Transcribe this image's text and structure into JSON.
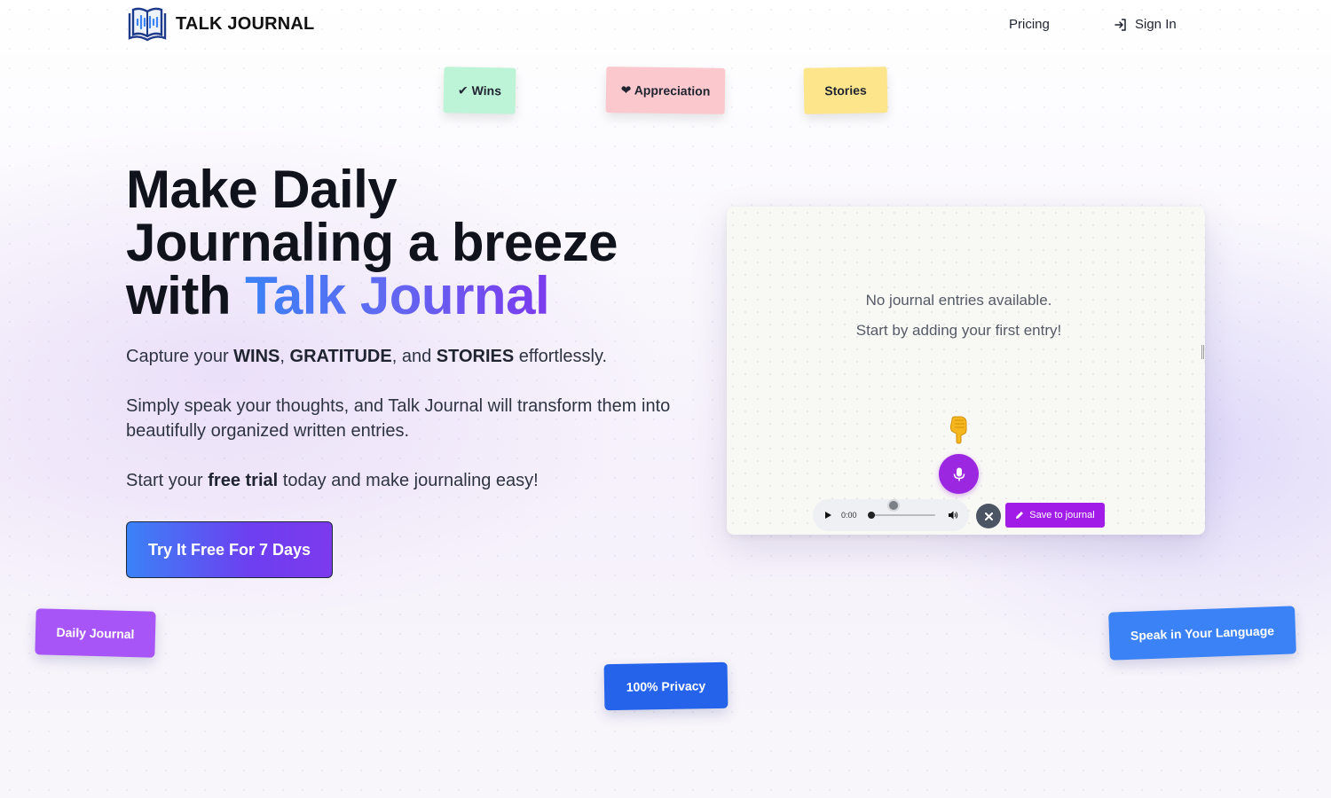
{
  "header": {
    "brand": "TALK JOURNAL",
    "nav": {
      "pricing": "Pricing",
      "sign_in": "Sign In"
    }
  },
  "tags": {
    "wins": "✔ Wins",
    "appreciation": "❤ Appreciation",
    "stories": "Stories"
  },
  "hero": {
    "title_lines": [
      "Make Daily",
      "Journaling a breeze",
      "with "
    ],
    "title_accent": "Talk Journal",
    "p1": {
      "a": "Capture your ",
      "b1": "WINS",
      "c": ", ",
      "b2": "GRATITUDE",
      "d": ", and ",
      "b3": "STORIES",
      "e": " effortlessly."
    },
    "p2": "Simply speak your thoughts, and Talk Journal will transform them into beautifully organized written entries.",
    "p3": {
      "a": "Start your ",
      "b": "free trial",
      "c": " today and make journaling easy!"
    },
    "cta": "Try It Free For 7 Days"
  },
  "card": {
    "empty_line1": "No journal entries available.",
    "empty_line2": "Start by adding your first entry!",
    "player": {
      "time": "0:00",
      "progress": 0
    },
    "save_label": "Save to journal"
  },
  "badges": {
    "daily": "Daily Journal",
    "privacy": "100% Privacy",
    "language": "Speak in Your Language"
  },
  "colors": {
    "accent_purple": "#9c27e0",
    "save_purple": "#a21ce8",
    "privacy_blue": "#2563eb",
    "daily_purple": "#a855f7"
  },
  "icons": [
    "logo-book-icon",
    "sign-in-icon",
    "pointing-down-icon",
    "microphone-icon",
    "play-icon",
    "volume-icon",
    "close-icon",
    "pencil-icon"
  ]
}
